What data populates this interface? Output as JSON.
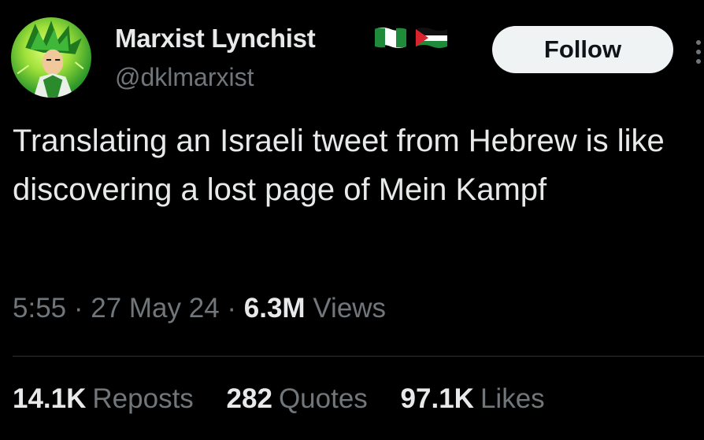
{
  "author": {
    "display_name": "Marxist Lynchist",
    "handle": "@dklmarxist",
    "flags": [
      "nigeria-flag",
      "palestine-flag"
    ],
    "avatar": "anime-character-avatar"
  },
  "follow_label": "Follow",
  "more_icon": "more-options-icon",
  "tweet": {
    "text": "Translating an Israeli tweet from Hebrew is like discovering a lost page of Mein Kampf"
  },
  "meta": {
    "time": "5:55",
    "sep1": " · ",
    "date": "27 May 24",
    "sep2": " · ",
    "views_count": "6.3M",
    "views_label": "Views"
  },
  "stats": {
    "reposts_count": "14.1K",
    "reposts_label": "Reposts",
    "quotes_count": "282",
    "quotes_label": "Quotes",
    "likes_count": "97.1K",
    "likes_label": "Likes"
  },
  "colors": {
    "background": "#000000",
    "primary_text": "#e7e9ea",
    "secondary_text": "#71767b",
    "button_bg": "#eff3f4",
    "button_text": "#0f1419",
    "divider": "#2f3336"
  }
}
